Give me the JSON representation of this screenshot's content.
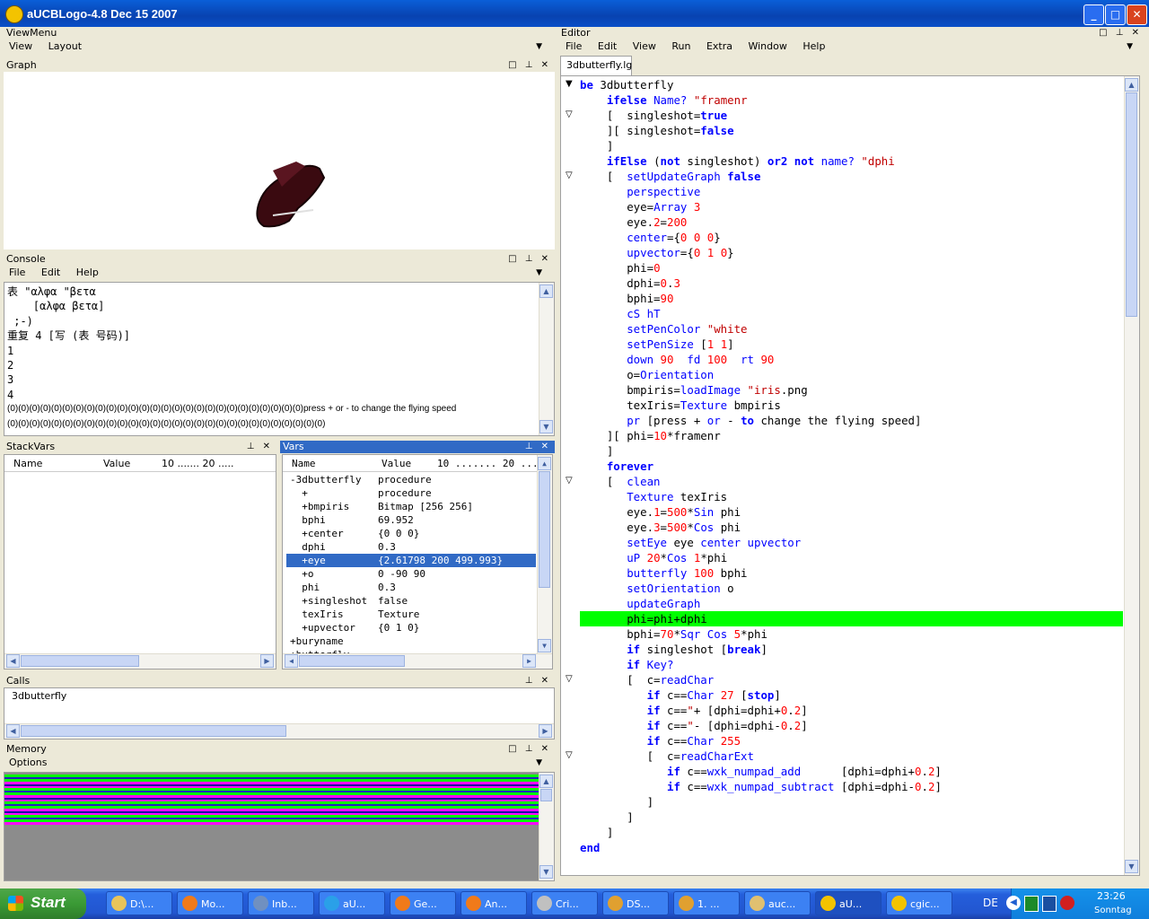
{
  "window": {
    "title": "aUCBLogo-4.8 Dec 15 2007",
    "min_btn": "_",
    "max_btn": "□",
    "close_btn": "✕"
  },
  "viewmenu": {
    "title": "ViewMenu",
    "items": [
      "View",
      "Layout"
    ]
  },
  "graph": {
    "title": "Graph"
  },
  "console": {
    "title": "Console",
    "menu": [
      "File",
      "Edit",
      "Help"
    ],
    "lines": [
      "表 \"αλφα \"βετα",
      "    [αλφα βετα]",
      " ;-)",
      "重复 4 [写 (表 号码)]",
      "1",
      "2",
      "3",
      "4",
      "(0)(0)(0)(0)(0)(0)(0)(0)(0)(0)(0)(0)(0)(0)(0)(0)(0)(0)(0)(0)(0)(0)(0)(0)(0)(0)(0)press + or - to change the flying speed",
      "(0)(0)(0)(0)(0)(0)(0)(0)(0)(0)(0)(0)(0)(0)(0)(0)(0)(0)(0)(0)(0)(0)(0)(0)(0)(0)(0)(0)(0)"
    ]
  },
  "stackvars": {
    "title": "StackVars",
    "columns": [
      "Name",
      "Value",
      "10 ....... 20 ....."
    ]
  },
  "vars": {
    "title": "Vars",
    "columns": [
      "Name",
      "Value",
      "10 ....... 20 ....."
    ],
    "rows": [
      {
        "name": "-3dbutterfly",
        "value": "procedure"
      },
      {
        "name": "  +",
        "value": "procedure"
      },
      {
        "name": "  +bmpiris",
        "value": "Bitmap [256 256]"
      },
      {
        "name": "  bphi",
        "value": "69.952"
      },
      {
        "name": "  +center",
        "value": "{0 0 0}"
      },
      {
        "name": "  dphi",
        "value": "0.3"
      },
      {
        "name": "  +eye",
        "value": "{2.61798 200 499.993}"
      },
      {
        "name": "  +o",
        "value": "0 -90 90"
      },
      {
        "name": "  phi",
        "value": "0.3"
      },
      {
        "name": "  +singleshot",
        "value": "false"
      },
      {
        "name": "  texIris",
        "value": "Texture"
      },
      {
        "name": "  +upvector",
        "value": "{0 1 0}"
      },
      {
        "name": "+buryname",
        "value": ""
      },
      {
        "name": "+butterfly",
        "value": ""
      }
    ],
    "selected_index": 6
  },
  "calls": {
    "title": "Calls",
    "items": [
      "3dbutterfly"
    ]
  },
  "memory": {
    "title": "Memory",
    "menu": [
      "Options"
    ]
  },
  "editor": {
    "title": "Editor",
    "menu": [
      "File",
      "Edit",
      "View",
      "Run",
      "Extra",
      "Window",
      "Help"
    ],
    "tab": "3dbutterfly.lg",
    "highlight_line": 35,
    "lines": [
      "be 3dbutterfly",
      "    ifelse Name? \"framenr",
      "    [  singleshot=true",
      "    ][ singleshot=false",
      "    ]",
      "    ifElse (not singleshot) or2 not name? \"dphi",
      "    [  setUpdateGraph false",
      "       perspective",
      "       eye=Array 3",
      "       eye.2=200",
      "       center={0 0 0}",
      "       upvector={0 1 0}",
      "       phi=0",
      "       dphi=0.3",
      "       bphi=90",
      "       cS hT",
      "       setPenColor \"white",
      "       setPenSize [1 1]",
      "       down 90  fd 100  rt 90",
      "       o=Orientation",
      "       bmpiris=loadImage \"iris.png",
      "       texIris=Texture bmpiris",
      "       pr [press + or - to change the flying speed]",
      "    ][ phi=10*framenr",
      "    ]",
      "    forever",
      "    [  clean",
      "       Texture texIris",
      "       eye.1=500*Sin phi",
      "       eye.3=500*Cos phi",
      "       setEye eye center upvector",
      "       uP 20*Cos 1*phi",
      "       butterfly 100 bphi",
      "       setOrientation o",
      "       updateGraph",
      "       phi=phi+dphi",
      "       bphi=70*Sqr Cos 5*phi",
      "       if singleshot [break]",
      "       if Key?",
      "       [  c=readChar",
      "          if c==Char 27 [stop]",
      "          if c==\"+ [dphi=dphi+0.2]",
      "          if c==\"- [dphi=dphi-0.2]",
      "          if c==Char 255",
      "          [  c=readCharExt",
      "             if c==wxk_numpad_add      [dphi=dphi+0.2]",
      "             if c==wxk_numpad_subtract [dphi=dphi-0.2]",
      "          ]",
      "       ]",
      "    ]",
      "end"
    ]
  },
  "taskbar": {
    "start": "Start",
    "tasks": [
      "D:\\...",
      "Mo...",
      "Inb...",
      "aU...",
      "Ge...",
      "An...",
      "Cri...",
      "DS...",
      "1. ...",
      "auc...",
      "aU...",
      "cgic..."
    ],
    "active_index": 10,
    "lang": "DE",
    "time": "23:26",
    "day": "Sonntag"
  },
  "colors": {
    "highlight": "#00ff00",
    "selection": "#316ac5",
    "titlebar": "#0842b0"
  }
}
